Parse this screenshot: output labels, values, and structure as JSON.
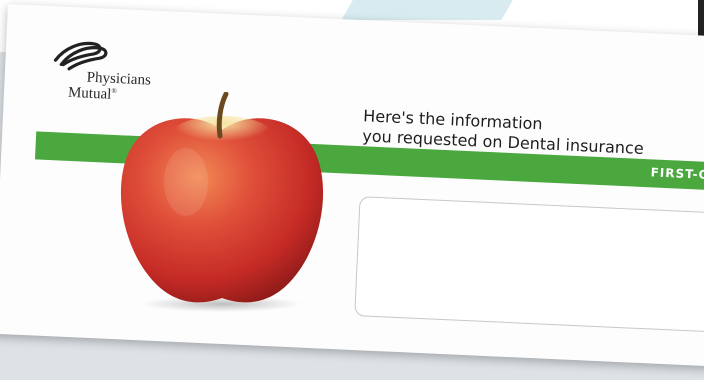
{
  "brand": {
    "name_line1": "Physicians",
    "name_line2": "Mutual",
    "registered_mark": "®",
    "accent_color": "#4aa83f"
  },
  "envelope": {
    "headline_line1": "Here's the information",
    "headline_line2": "you requested on Dental insurance",
    "postage_label": "FIRST-CL"
  },
  "icons": {
    "logo": "interlocked-loops-logo-icon",
    "image": "red-apple-icon"
  }
}
